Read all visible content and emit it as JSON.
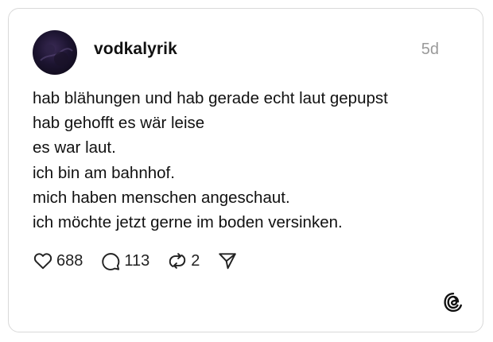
{
  "post": {
    "username": "vodkalyrik",
    "timestamp": "5d",
    "lines": [
      "hab blähungen und hab gerade echt laut gepupst",
      "hab gehofft es wär leise",
      "es war laut.",
      "ich bin am bahnhof.",
      "mich haben menschen angeschaut.",
      "ich möchte jetzt gerne im boden versinken."
    ]
  },
  "actions": {
    "likes": "688",
    "replies": "113",
    "reposts": "2"
  },
  "icons": {
    "like": "heart-icon",
    "reply": "speech-bubble-icon",
    "repost": "repost-arrows-icon",
    "share": "send-icon",
    "brand": "threads-logo-icon"
  },
  "colors": {
    "text": "#111111",
    "muted": "#9a9a9a",
    "border": "#d9d9d9"
  }
}
